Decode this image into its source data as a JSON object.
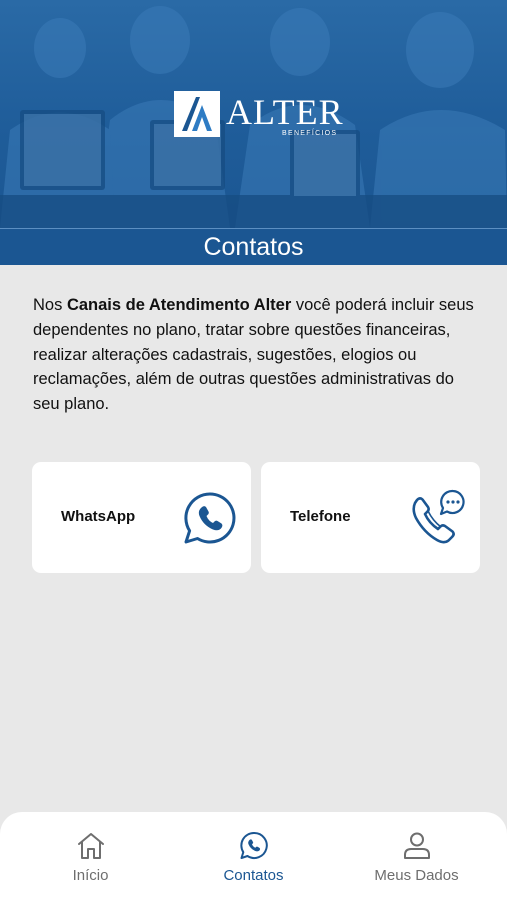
{
  "header": {
    "logo_word": "ALTER",
    "logo_sub": "BENEFÍCIOS",
    "title": "Contatos"
  },
  "intro": {
    "prefix": "Nos ",
    "bold": "Canais de Atendimento Alter",
    "suffix": " você poderá incluir seus dependentes no plano, tratar sobre questões financeiras, realizar alterações cadastrais, sugestões, elogios ou reclamações, além de outras questões administrativas do seu plano."
  },
  "cards": {
    "whatsapp": {
      "label": "WhatsApp",
      "icon": "whatsapp-icon"
    },
    "telefone": {
      "label": "Telefone",
      "icon": "phone-chat-icon"
    }
  },
  "nav": {
    "items": [
      {
        "label": "Início",
        "icon": "home-icon",
        "active": false
      },
      {
        "label": "Contatos",
        "icon": "whatsapp-icon",
        "active": true
      },
      {
        "label": "Meus Dados",
        "icon": "user-icon",
        "active": false
      }
    ]
  },
  "colors": {
    "brand_blue": "#1b5692",
    "background": "#e8e8e8",
    "inactive_nav": "#6e6e6e"
  }
}
